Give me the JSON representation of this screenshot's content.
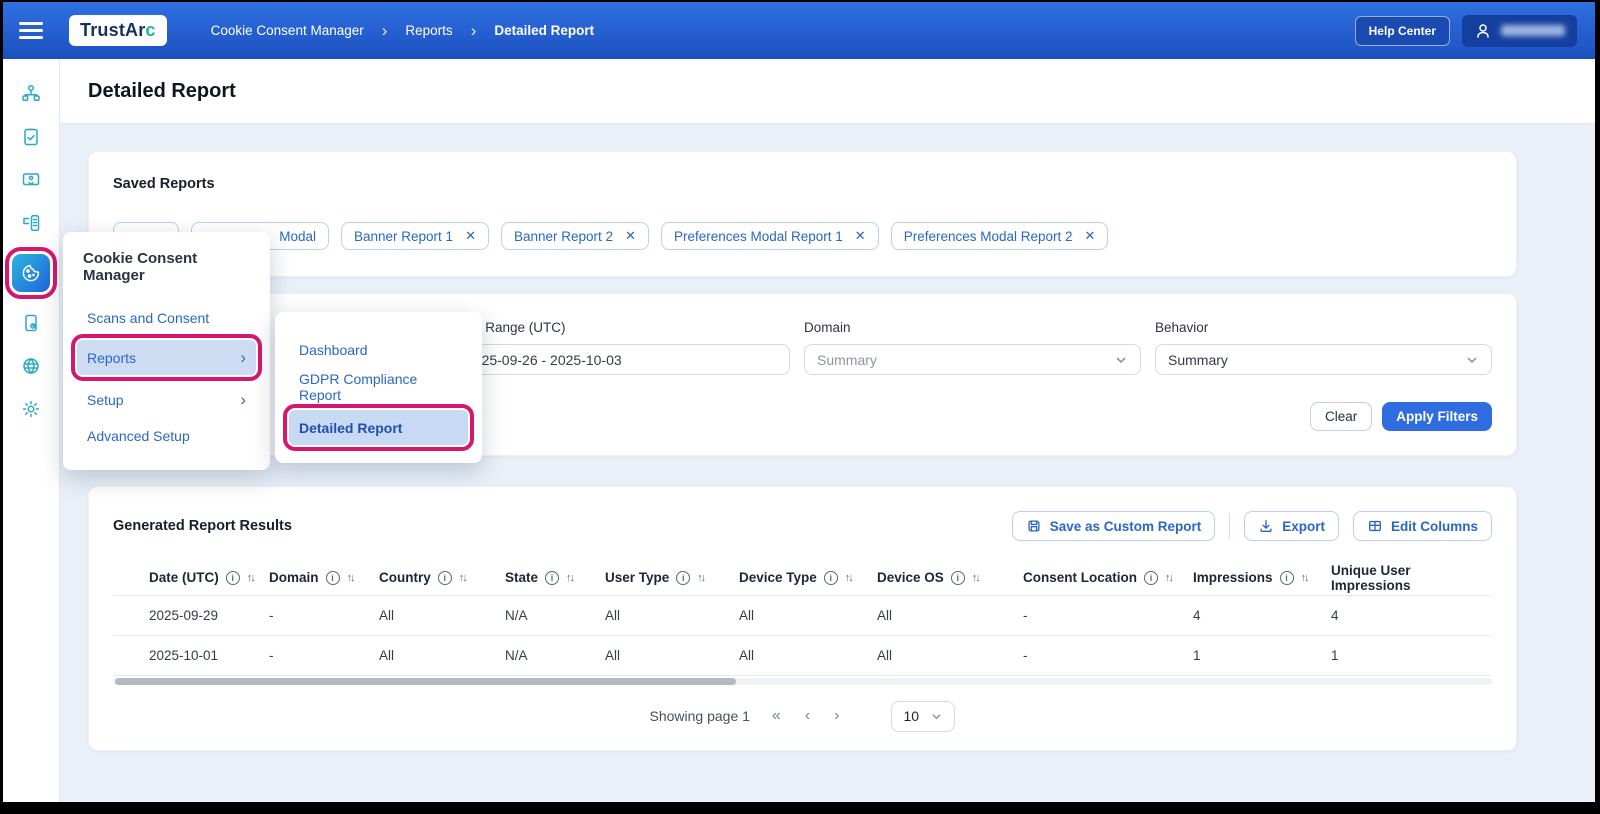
{
  "colors": {
    "header_blue_top": "#2F70E2",
    "header_blue_bottom": "#1D50BF",
    "accent_pink": "#D6176F",
    "link_blue": "#2A66C8",
    "sidebar_teal": "#2BA8C6",
    "apply_button_blue": "#2E6CE0",
    "highlight_row_blue": "#CDDCF3",
    "content_background": "#EAF0F8"
  },
  "icons": {
    "breadcrumb_sep": "›",
    "close": "✕",
    "info": "i",
    "sort": "↑↓",
    "page_first": "«",
    "page_prev": "‹",
    "page_next": "›",
    "submenu_arrow": "›"
  },
  "header": {
    "logo_main": "TrustAr",
    "logo_accent": "c",
    "breadcrumb": [
      "Cookie Consent Manager",
      "Reports",
      "Detailed Report"
    ],
    "help_center": "Help Center"
  },
  "sidebar": {
    "items": [
      "sitemap",
      "clipboard-check",
      "banner-display",
      "form-list",
      "cookie",
      "device-policy",
      "globe-brain",
      "settings-gear"
    ],
    "active_item": "cookie"
  },
  "page": {
    "title": "Detailed Report"
  },
  "saved_reports": {
    "title": "Saved Reports",
    "chips": [
      {
        "label": "",
        "closable": false
      },
      {
        "label": "Modal",
        "closable": false
      },
      {
        "label": "Banner Report 1",
        "closable": true
      },
      {
        "label": "Banner Report 2",
        "closable": true
      },
      {
        "label": "Preferences Modal Report 1",
        "closable": true
      },
      {
        "label": "Preferences Modal Report 2",
        "closable": true
      }
    ]
  },
  "menu": {
    "title": "Cookie Consent Manager",
    "items": [
      {
        "label": "Scans and Consent"
      },
      {
        "label": "Reports",
        "has_submenu": true,
        "highlighted": true
      },
      {
        "label": "Setup",
        "has_submenu": true
      },
      {
        "label": "Advanced Setup"
      }
    ],
    "submenu": [
      {
        "label": "Dashboard"
      },
      {
        "label": "GDPR Compliance Report"
      },
      {
        "label": "Detailed Report",
        "highlighted": true
      }
    ]
  },
  "filters": {
    "date_label": "Date Range (UTC)",
    "date_value": "2025-09-26 - 2025-10-03",
    "domain_label": "Domain",
    "domain_value": "Summary",
    "behavior_label": "Behavior",
    "behavior_value": "Summary",
    "clear_label": "Clear",
    "apply_label": "Apply Filters"
  },
  "results": {
    "title": "Generated Report Results",
    "save_button": "Save as Custom Report",
    "export_button": "Export",
    "edit_columns_button": "Edit Columns",
    "table": {
      "columns": [
        "Date (UTC)",
        "Domain",
        "Country",
        "State",
        "User Type",
        "Device Type",
        "Device OS",
        "Consent Location",
        "Impressions",
        "Unique User Impressions"
      ],
      "rows": [
        [
          "2025-09-29",
          "-",
          "All",
          "N/A",
          "All",
          "All",
          "All",
          "-",
          "4",
          "4"
        ],
        [
          "2025-10-01",
          "-",
          "All",
          "N/A",
          "All",
          "All",
          "All",
          "-",
          "1",
          "1"
        ]
      ]
    },
    "pagination": {
      "showing": "Showing page 1",
      "page_size": "10"
    }
  }
}
